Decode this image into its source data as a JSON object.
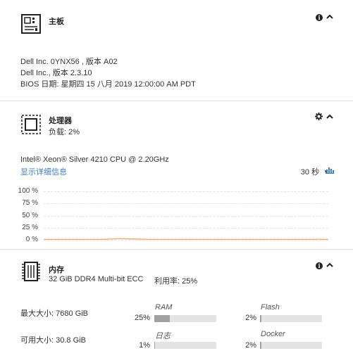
{
  "motherboard": {
    "title": "主板",
    "line1": "Dell Inc. 0YNX56 , 版本 A02",
    "line2": "Dell Inc., 版本 2.3.10",
    "line3": "BIOS 日期: 星期四 15 八月 2019 12:00:00 AM PDT"
  },
  "processor": {
    "title": "处理器",
    "load": "负载: 2%",
    "model": "Intel® Xeon® Silver 4210 CPU @ 2.20GHz",
    "details_link": "显示详细信息",
    "interval": "30 秒",
    "interval_arrow": "▼"
  },
  "chart_data": {
    "type": "line",
    "title": "",
    "xlabel": "",
    "ylabel": "",
    "yticks": [
      "100 %",
      "75 %",
      "50 %",
      "25 %",
      "0 %"
    ],
    "ylim": [
      0,
      100
    ],
    "x": [
      0,
      1,
      2,
      3,
      4,
      5,
      6,
      7,
      8,
      9,
      10,
      11,
      12,
      13,
      14,
      15,
      16,
      17,
      18,
      19,
      20,
      21,
      22,
      23,
      24,
      25,
      26,
      27,
      28,
      29,
      30
    ],
    "series": [
      {
        "values": [
          1,
          1,
          1,
          1,
          1,
          1,
          1,
          1.5,
          2.5,
          2,
          1.5,
          1,
          1,
          1,
          1,
          1,
          1,
          1,
          1,
          1,
          1,
          1,
          1,
          1,
          1,
          1,
          1,
          1,
          1,
          1.2,
          1
        ]
      }
    ],
    "line_color": "#f0a050",
    "grid": true
  },
  "memory": {
    "title": "内存",
    "spec": "32 GiB DDR4 Multi-bit ECC",
    "usage": "利用率: 25%",
    "max_size": "最大大小: 7680 GiB",
    "available_size": "可用大小: 30.8 GiB",
    "bars": [
      {
        "name": "RAM",
        "pct_label": "25%",
        "fraction": 0.25
      },
      {
        "name": "Flash",
        "pct_label": "2%",
        "fraction": 0.02
      },
      {
        "name": "日志",
        "pct_label": "1%",
        "fraction": 0.01
      },
      {
        "name": "Docker",
        "pct_label": "2%",
        "fraction": 0.02
      }
    ]
  },
  "icons": {
    "info": "i",
    "collapse": "⌃",
    "gear": "✱",
    "chart": "bar-chart-icon"
  }
}
